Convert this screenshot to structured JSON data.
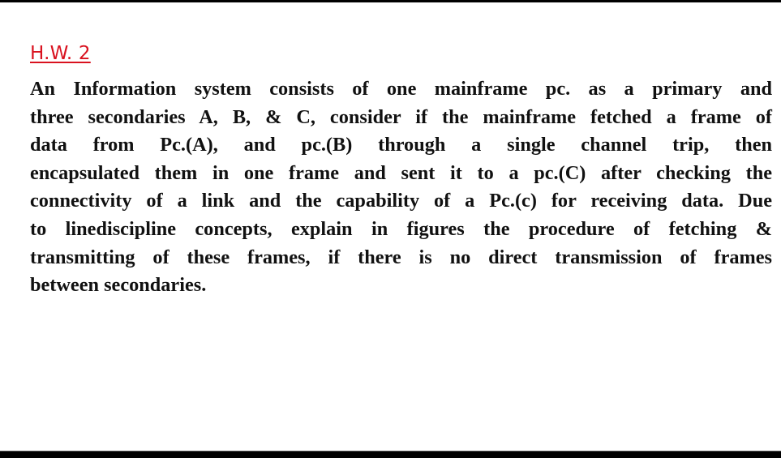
{
  "document": {
    "heading": "H.W. 2",
    "colors": {
      "heading": "#d9121f",
      "body_text": "#111111",
      "background": "#ffffff",
      "frame_bars": "#000000"
    },
    "paragraph_lines": [
      "An Information system consists of one mainframe pc. as a primary and",
      "three secondaries A, B, & C, consider if the mainframe fetched a frame of",
      "data from Pc.(A), and pc.(B) through a single channel trip, then",
      "encapsulated them in one frame and sent it to a pc.(C) after checking the",
      "connectivity of a link and the capability of a Pc.(c) for receiving data. Due",
      "to linediscipline concepts, explain in figures the procedure of fetching &",
      "transmitting of these frames, if there is no direct transmission of frames",
      "between secondaries."
    ]
  }
}
